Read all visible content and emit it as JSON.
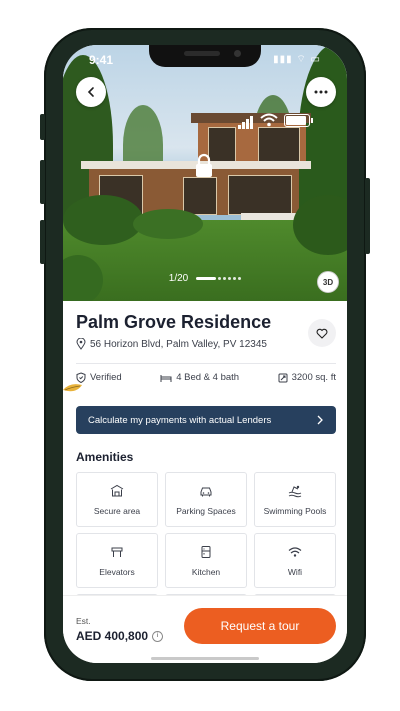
{
  "status_bar": {
    "time": "9:41"
  },
  "hero": {
    "gallery_counter": "1/20",
    "view_3d_label": "3D",
    "back_icon": "chevron-left-icon",
    "more_icon": "more-horizontal-icon",
    "signal_icon": "signal-bars-icon",
    "wifi_icon": "wifi-icon",
    "battery_icon": "battery-icon",
    "lock_icon": "lock-icon"
  },
  "property": {
    "title": "Palm Grove Residence",
    "address": "56 Horizon Blvd, Palm Valley, PV 12345",
    "favorite_icon": "heart-icon",
    "stats": [
      {
        "icon": "shield-icon",
        "label": "Verified"
      },
      {
        "icon": "bed-icon",
        "label": "4 Bed & 4 bath"
      },
      {
        "icon": "area-icon",
        "label": "3200 sq. ft"
      }
    ]
  },
  "lender_banner": {
    "label": "Calculate my payments with actual Lenders"
  },
  "amenities": {
    "title": "Amenities",
    "items": [
      {
        "icon": "security-building-icon",
        "label": "Secure area"
      },
      {
        "icon": "car-icon",
        "label": "Parking Spaces"
      },
      {
        "icon": "pool-icon",
        "label": "Swimming Pools"
      },
      {
        "icon": "elevator-icon",
        "label": "Elevators"
      },
      {
        "icon": "fridge-icon",
        "label": "Kitchen"
      },
      {
        "icon": "wifi-icon",
        "label": "Wifi"
      }
    ]
  },
  "footer": {
    "est_label": "Est.",
    "price": "AED 400,800",
    "cta_label": "Request a tour"
  },
  "colors": {
    "phone_frame": "#1c2a22",
    "banner": "#27405e",
    "cta": "#ec5e21",
    "text_primary": "#1c2130"
  }
}
